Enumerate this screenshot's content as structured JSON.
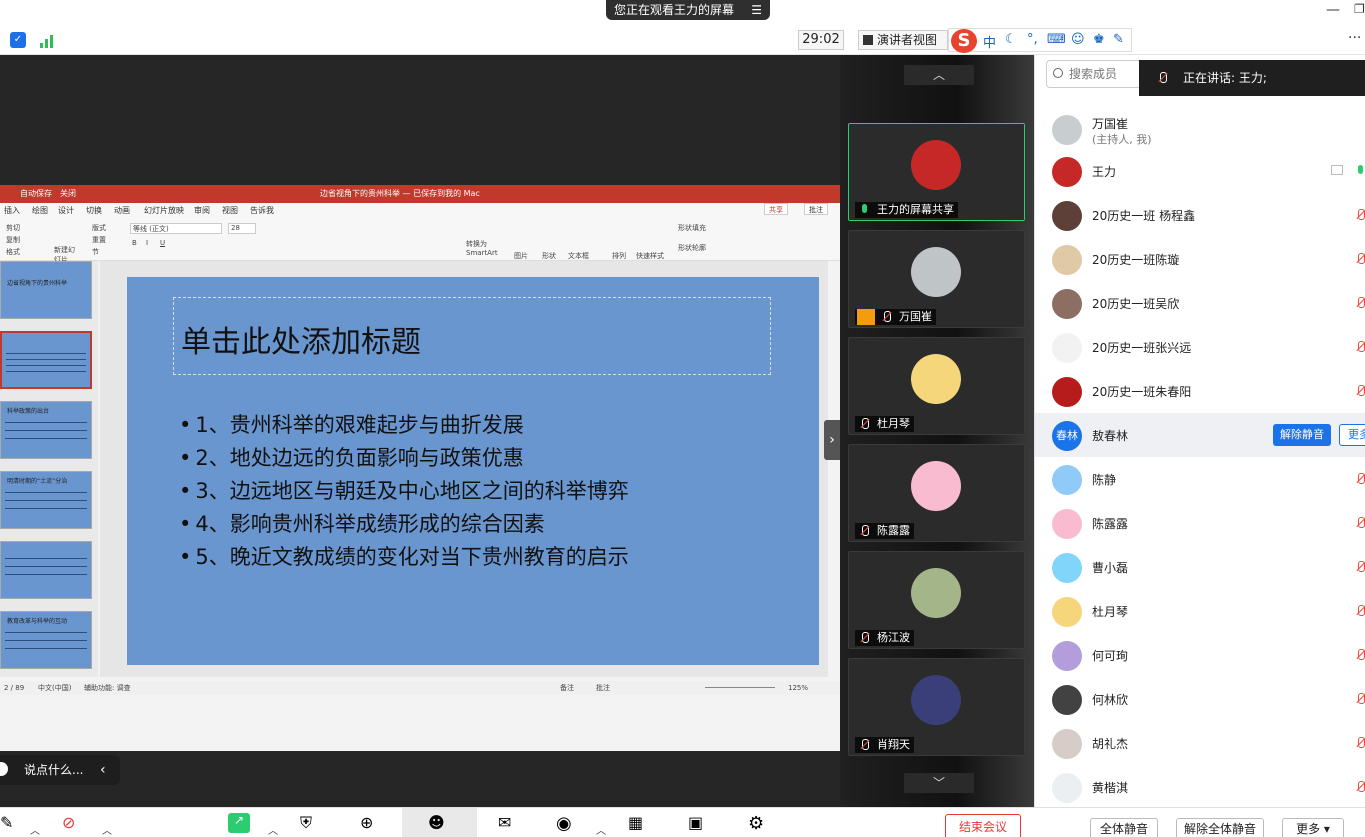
{
  "topbar": {
    "viewing": "您正在观看王力的屏幕",
    "timer": "29:02",
    "presenter_view": "演讲者视图",
    "ime_logo": "S",
    "ime_lang": "中"
  },
  "ppt": {
    "autosave": "自动保存",
    "autosave_state": "关闭",
    "doc_title": "边省视角下的贵州科举 — 已保存到我的 Mac",
    "tabs": [
      "插入",
      "绘图",
      "设计",
      "切换",
      "动画",
      "幻灯片放映",
      "审阅",
      "视图",
      "告诉我"
    ],
    "share": "共享",
    "comment": "批注",
    "ribbon": {
      "cut": "剪切",
      "copy": "复制",
      "format": "格式",
      "new_slide": "新建幻灯片",
      "layout": "版式",
      "reset": "重置",
      "section": "节",
      "font_name": "等线 (正文)",
      "font_size": "28",
      "convert": "转换为SmartArt",
      "picture": "图片",
      "shape": "形状",
      "textbox": "文本框",
      "arrange": "排列",
      "quick_styles": "快速样式",
      "shape_fill": "形状填充",
      "shape_outline": "形状轮廓"
    },
    "slide": {
      "title": "单击此处添加标题",
      "bullets": [
        "1、贵州科举的艰难起步与曲折发展",
        "2、地处边远的负面影响与政策优惠",
        "3、边远地区与朝廷及中心地区之间的科举博弈",
        "4、影响贵州科举成绩形成的综合因素",
        "5、晚近文教成绩的变化对当下贵州教育的启示"
      ]
    },
    "thumb_titles": [
      "边省视角下的贵州科举",
      "",
      "科举政策的出台",
      "明清时期的“土流”分治",
      "",
      "教育改革与科举的互动"
    ],
    "status": {
      "slide": "2 / 89",
      "lang": "中文(中国)",
      "access": "辅助功能: 调查",
      "notes": "备注",
      "comments": "批注",
      "zoom": "125%"
    }
  },
  "say": "说点什么...",
  "video_tiles": [
    {
      "name": "王力的屏幕共享",
      "active": true
    },
    {
      "name": "万国崔"
    },
    {
      "name": "杜月琴"
    },
    {
      "name": "陈露露"
    },
    {
      "name": "杨江波"
    },
    {
      "name": "肖翔天"
    }
  ],
  "panel": {
    "search_placeholder": "搜索成员",
    "speaking": "正在讲话: 王力;",
    "participants": [
      {
        "name": "万国崔",
        "sub": "(主持人, 我)"
      },
      {
        "name": "王力"
      },
      {
        "name": "20历史一班 杨程鑫"
      },
      {
        "name": "20历史一班陈璇"
      },
      {
        "name": "20历史一班吴欣"
      },
      {
        "name": "20历史一班张兴远"
      },
      {
        "name": "20历史一班朱春阳"
      },
      {
        "name": "敖春林",
        "avatar_text": "春林"
      },
      {
        "name": "陈静"
      },
      {
        "name": "陈露露"
      },
      {
        "name": "曹小磊"
      },
      {
        "name": "杜月琴"
      },
      {
        "name": "何可珣"
      },
      {
        "name": "何林欣"
      },
      {
        "name": "胡礼杰"
      },
      {
        "name": "黄楷淇"
      }
    ],
    "unmute": "解除静音",
    "more_row": "更多"
  },
  "toolbar": {
    "end_meeting": "结束会议",
    "mute_all": "全体静音",
    "unmute_all": "解除全体静音",
    "more": "更多 ▾"
  },
  "colors": {
    "accent": "#1a73e8",
    "ppt_red": "#c0392b",
    "slide_blue": "#6a96d0",
    "end_red": "#e53935",
    "active_green": "#2ecc71"
  }
}
